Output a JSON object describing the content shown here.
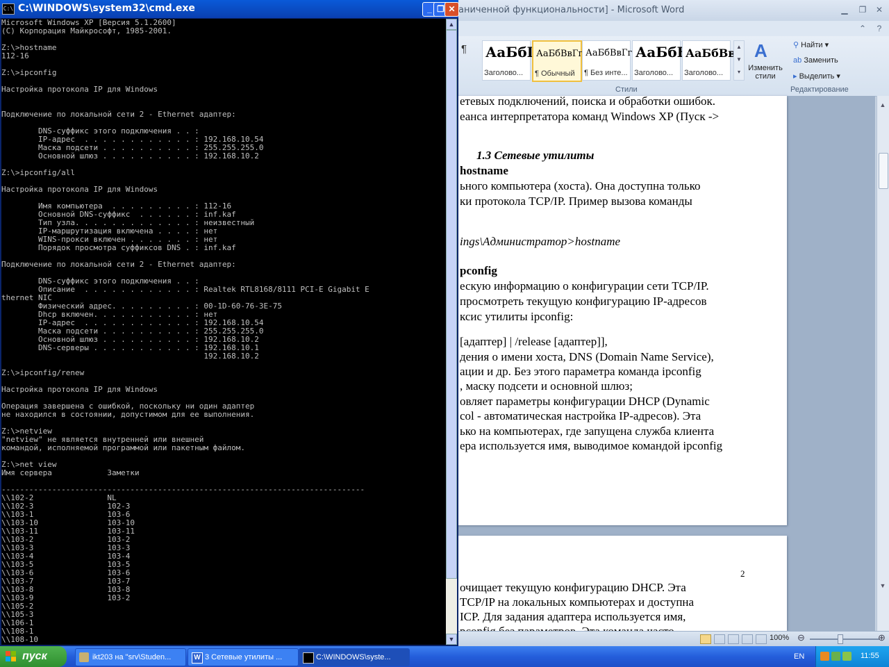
{
  "cmd": {
    "title": "C:\\WINDOWS\\system32\\cmd.exe",
    "icon_text": "C:\\",
    "lines": [
      "Microsoft Windows XP [Версия 5.1.2600]",
      "(С) Корпорация Майкрософт, 1985-2001.",
      "",
      "Z:\\>hostname",
      "112-16",
      "",
      "Z:\\>ipconfig",
      "",
      "Настройка протокола IP для Windows",
      "",
      "",
      "Подключение по локальной сети 2 - Ethernet адаптер:",
      "",
      "        DNS-суффикс этого подключения . . :",
      "        IP-адрес  . . . . . . . . . . . . : 192.168.10.54",
      "        Маска подсети . . . . . . . . . . : 255.255.255.0",
      "        Основной шлюз . . . . . . . . . . : 192.168.10.2",
      "",
      "Z:\\>ipconfig/all",
      "",
      "Настройка протокола IP для Windows",
      "",
      "        Имя компьютера  . . . . . . . . . : 112-16",
      "        Основной DNS-суффикс  . . . . . . : inf.kaf",
      "        Тип узла. . . . . . . . . . . . . : неизвестный",
      "        IP-маршрутизация включена . . . . : нет",
      "        WINS-прокси включен . . . . . . . : нет",
      "        Порядок просмотра суффиксов DNS . : inf.kaf",
      "",
      "Подключение по локальной сети 2 - Ethernet адаптер:",
      "",
      "        DNS-суффикс этого подключения . . :",
      "        Описание  . . . . . . . . . . . . : Realtek RTL8168/8111 PCI-E Gigabit E",
      "thernet NIC",
      "        Физический адрес. . . . . . . . . : 00-1D-60-76-3E-75",
      "        Dhcp включен. . . . . . . . . . . : нет",
      "        IP-адрес  . . . . . . . . . . . . : 192.168.10.54",
      "        Маска подсети . . . . . . . . . . : 255.255.255.0",
      "        Основной шлюз . . . . . . . . . . : 192.168.10.2",
      "        DNS-серверы . . . . . . . . . . . : 192.168.10.1",
      "                                            192.168.10.2",
      "",
      "Z:\\>ipconfig/renew",
      "",
      "Настройка протокола IP для Windows",
      "",
      "Операция завершена с ошибкой, поскольку ни один адаптер",
      "не находился в состоянии, допустимом для ее выполнения.",
      "",
      "Z:\\>netview",
      "\"netview\" не является внутренней или внешней",
      "командой, исполняемой программой или пакетным файлом.",
      "",
      "Z:\\>net view",
      "Имя сервера            Заметки",
      "",
      "-------------------------------------------------------------------------------",
      "\\\\102-2                NL",
      "\\\\102-3                102-3",
      "\\\\103-1                103-6",
      "\\\\103-10               103-10",
      "\\\\103-11               103-11",
      "\\\\103-2                103-2",
      "\\\\103-3                103-3",
      "\\\\103-4                103-4",
      "\\\\103-5                103-5",
      "\\\\103-6                103-6",
      "\\\\103-7                103-7",
      "\\\\103-8                103-8",
      "\\\\103-9                103-2",
      "\\\\105-2",
      "\\\\105-3",
      "\\\\106-1",
      "\\\\108-1",
      "\\\\108-10"
    ]
  },
  "word": {
    "title": "аниченной функциональности] - Microsoft Word",
    "styles": [
      {
        "sample": "АаБбІ",
        "name": "Заголово..."
      },
      {
        "sample": "АаБбВвГг,",
        "name": "¶ Обычный"
      },
      {
        "sample": "АаБбВвГг,",
        "name": "¶ Без инте..."
      },
      {
        "sample": "АаБбЕ",
        "name": "Заголово..."
      },
      {
        "sample": "АаБбВв",
        "name": "Заголово..."
      }
    ],
    "pilcrow": "¶",
    "change_styles_label": "Изменить стили",
    "styles_group": "Стили",
    "editing_group": "Редактирование",
    "find_label": "Найти",
    "replace_label": "Заменить",
    "select_label": "Выделить",
    "page1_lines": [
      "етевых подключений, поиска и обработки ошибок.",
      "еанса интерпретатора команд Windows XP (Пуск ->",
      "1.3 Сетевые утилиты",
      "hostname",
      "ьного  компьютера  (хоста).  Она  доступна  только",
      "ки  протокола  TCP/IP.  Пример  вызова  команды",
      "ings\\Администратор>hostname",
      "pconfig",
      "ескую информацию о конфигурации сети TCP/IP.",
      "просмотреть  текущую  конфигурацию  IP-адресов",
      "ксис утилиты ipconfig:",
      "[адаптер] | /release [адаптер]],",
      "дения о имени хоста, DNS (Domain Name Service),",
      "ации и др. Без этого параметра команда ipconfig",
      ", маску подсети и основной шлюз;",
      "овляет параметры конфигурации DHCP (Dynamic",
      "col - автоматическая настройка IP-адресов). Эта",
      "ько на компьютерах, где запущена служба клиента",
      "ера используется имя, выводимое командой ipconfig"
    ],
    "page2_lines": [
      "2",
      "очищает  текущую  конфигурацию  DHCP.  Эта",
      "TCP/IP  на  локальных  компьютерах  и  доступна",
      "ICP.  Для  задания  адаптера  используется  имя,",
      "pconfig  без  параметров.  Эта  команда  часто"
    ],
    "zoom": "100%"
  },
  "taskbar": {
    "start_label": "пуск",
    "tasks": [
      {
        "label": "ikt203 на \"srv\\Studen..."
      },
      {
        "label": "3 Сетевые утилиты ..."
      },
      {
        "label": "C:\\WINDOWS\\syste..."
      }
    ],
    "language": "EN",
    "clock": "11:55"
  }
}
